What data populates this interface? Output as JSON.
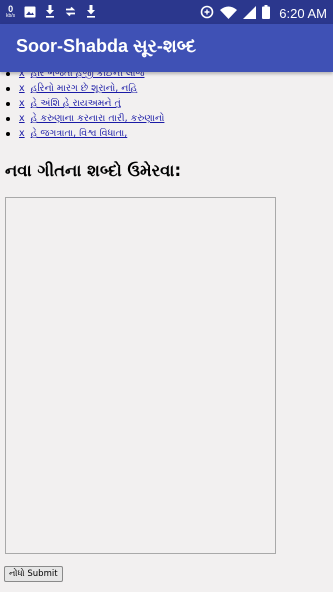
{
  "status_bar": {
    "net_speed_value": "0",
    "net_speed_unit": "kb/s",
    "time": "6:20",
    "ampm": "AM",
    "left_icons": [
      "image-icon",
      "download-icon",
      "sync-icon",
      "download-icon"
    ],
    "right_icons": [
      "data-saver-icon",
      "wifi-icon",
      "signal-icon",
      "battery-icon"
    ]
  },
  "app_bar": {
    "title": "Soor-Shabda સૂર-શબ્દ",
    "background": "#3f51b5",
    "status_background": "#2b378d"
  },
  "song_list": {
    "delete_label": "x",
    "items": [
      "હરિ ભજતાં હજી કોઈની લાજ",
      "હરિનો મારગ છે શૂરાનો, નહિ",
      "હે અંશિ હે રાયઅમને તું",
      "હે કરુણાના કરનારા તારી, કરુણાનો",
      "હે જગત્રાતા, વિશ્વ વિધાતા,"
    ]
  },
  "new_song": {
    "heading": "નવા ગીતના શબ્દો ઉમેરવા:",
    "textarea_value": "",
    "submit_label": "નોંધો Submit"
  },
  "colors": {
    "link": "#1a1aa6",
    "page_background": "#f2f0f0"
  }
}
